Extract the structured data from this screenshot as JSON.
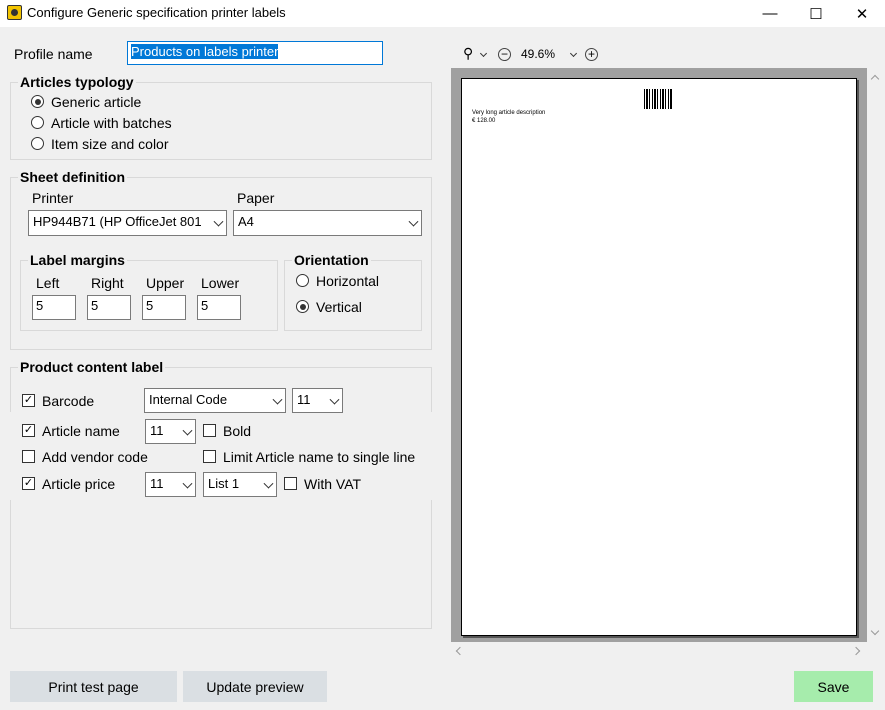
{
  "window": {
    "title": "Configure Generic specification printer labels",
    "minimize": "—",
    "maximize": "☐",
    "close": "✕"
  },
  "profile": {
    "label": "Profile name",
    "value": "Products on labels printer"
  },
  "articles_typology": {
    "title": "Articles typology",
    "options": [
      {
        "label": "Generic article",
        "selected": true
      },
      {
        "label": "Article with batches",
        "selected": false
      },
      {
        "label": "Item size and color",
        "selected": false
      }
    ]
  },
  "sheet": {
    "title": "Sheet definition",
    "printer_label": "Printer",
    "printer_value": "HP944B71 (HP OfficeJet 801",
    "paper_label": "Paper",
    "paper_value": "A4",
    "margins": {
      "title": "Label margins",
      "left_label": "Left",
      "left": "5",
      "right_label": "Right",
      "right": "5",
      "upper_label": "Upper",
      "upper": "5",
      "lower_label": "Lower",
      "lower": "5"
    },
    "orientation": {
      "title": "Orientation",
      "horizontal": "Horizontal",
      "vertical": "Vertical",
      "selected": "Vertical"
    }
  },
  "content": {
    "title": "Product content label",
    "barcode": {
      "label": "Barcode",
      "checked": true,
      "type": "Internal Code",
      "size": "11"
    },
    "article_name": {
      "label": "Article name",
      "checked": true,
      "size": "11",
      "bold_label": "Bold",
      "bold": false
    },
    "vendor_code": {
      "label": "Add vendor code",
      "checked": false,
      "limit_label": "Limit Article name to single line",
      "limit": false
    },
    "article_price": {
      "label": "Article price",
      "checked": true,
      "size": "11",
      "list": "List 1",
      "vat_label": "With VAT",
      "vat": false
    }
  },
  "preview": {
    "zoom": "49.6%",
    "description": "Very long article description",
    "price": "€ 128.00",
    "barcode_text": "Ll.."
  },
  "buttons": {
    "print_test": "Print test page",
    "update_preview": "Update preview",
    "save": "Save"
  }
}
